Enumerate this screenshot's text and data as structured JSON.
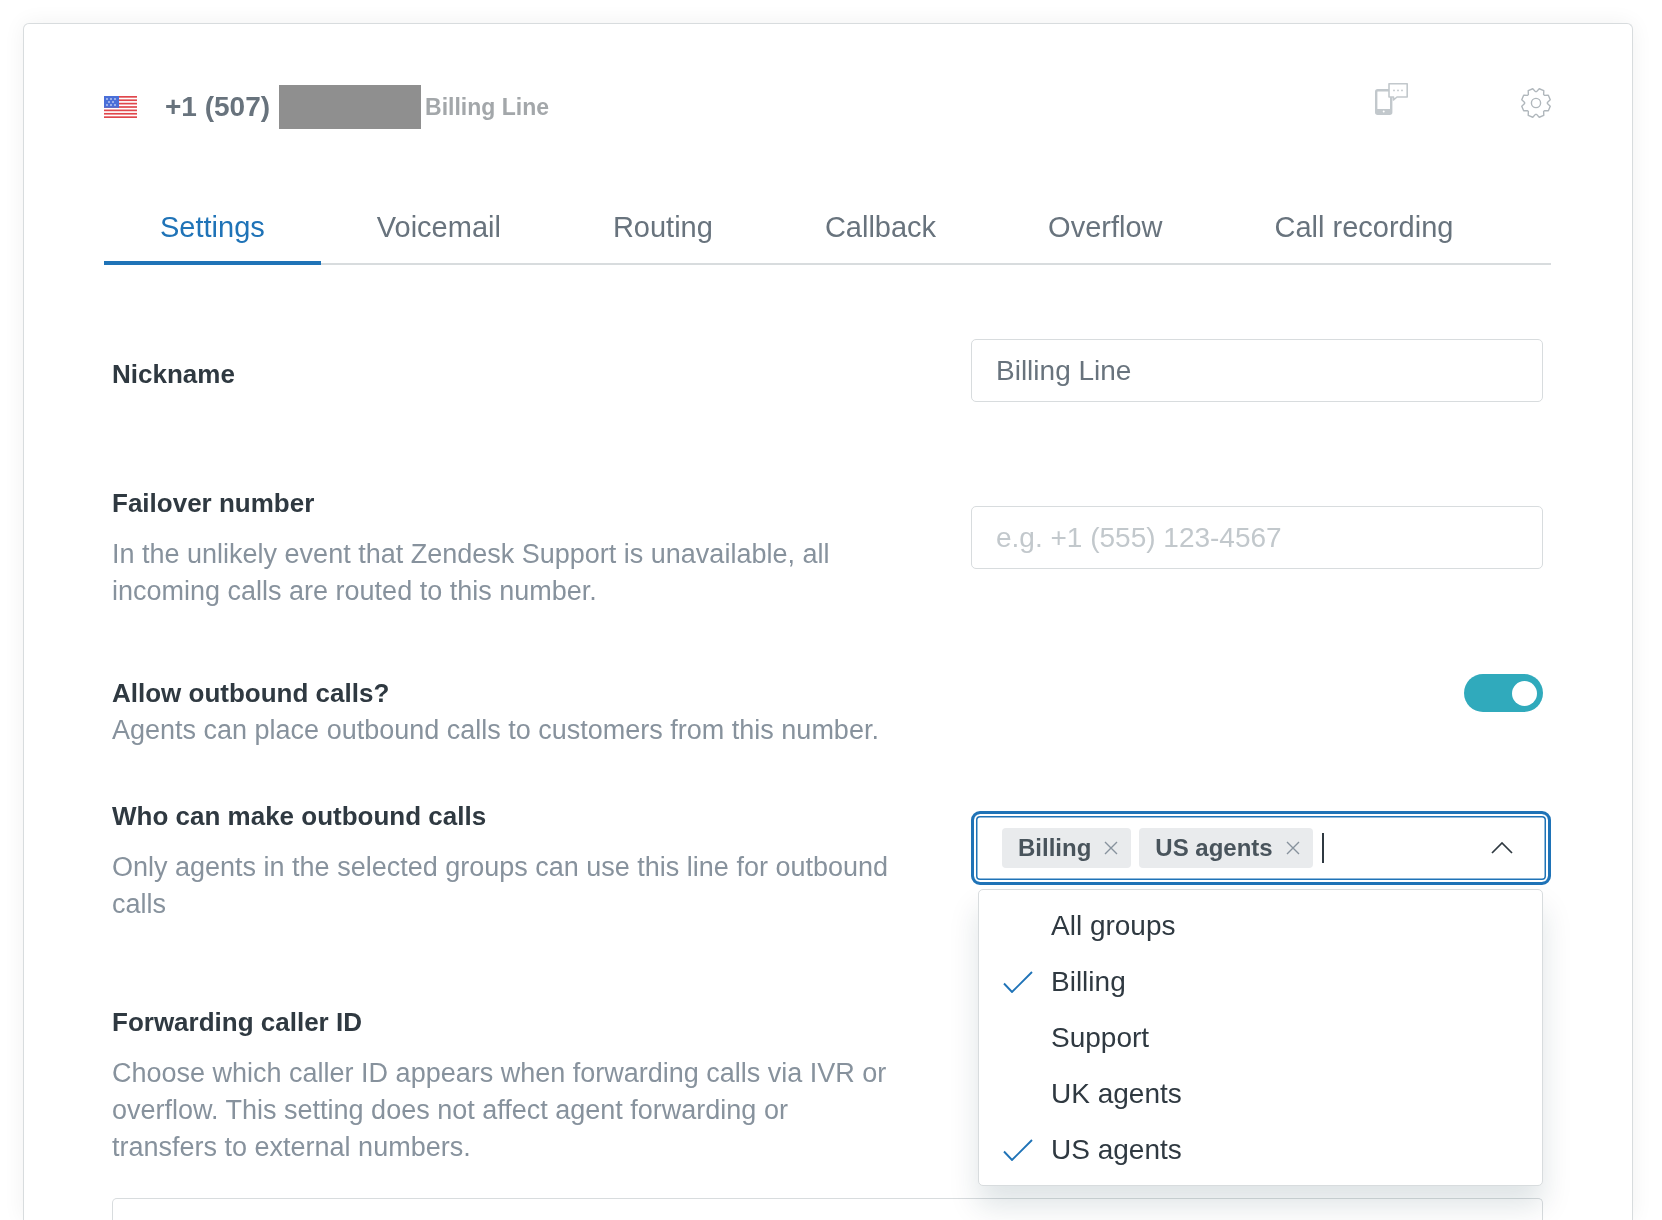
{
  "header": {
    "phone": "+1 (507)",
    "nickname": "Billing Line"
  },
  "tabs": [
    {
      "label": "Settings",
      "selected": true
    },
    {
      "label": "Voicemail",
      "selected": false
    },
    {
      "label": "Routing",
      "selected": false
    },
    {
      "label": "Callback",
      "selected": false
    },
    {
      "label": "Overflow",
      "selected": false
    },
    {
      "label": "Call recording",
      "selected": false
    }
  ],
  "settings": [
    {
      "kind": "text_input",
      "label": "Nickname",
      "value": "Billing Line"
    },
    {
      "kind": "text_input",
      "label": "Failover number",
      "description": "In the unlikely event that Zendesk Support is unavailable, all incoming calls are routed to this number.",
      "placeholder": "e.g. +1 (555) 123-4567"
    },
    {
      "kind": "toggle",
      "label": "Allow outbound calls?",
      "description": "Agents can place outbound calls to customers from this number.",
      "on": true
    },
    {
      "kind": "multiselect",
      "label": "Who can make outbound calls",
      "description": "Only agents in the selected groups can use this line for outbound calls",
      "tags": [
        "Billing",
        "US agents"
      ],
      "focused": true,
      "expanded": true,
      "options": [
        {
          "label": "All groups",
          "selected": false
        },
        {
          "label": "Billing",
          "selected": true
        },
        {
          "label": "Support",
          "selected": false
        },
        {
          "label": "UK agents",
          "selected": false
        },
        {
          "label": "US agents",
          "selected": true
        }
      ]
    },
    {
      "kind": "wide_input",
      "label": "Forwarding caller ID",
      "description": "Choose which caller ID appears when forwarding calls via IVR or overflow. This setting does not affect agent forwarding or transfers to external numbers."
    }
  ]
}
